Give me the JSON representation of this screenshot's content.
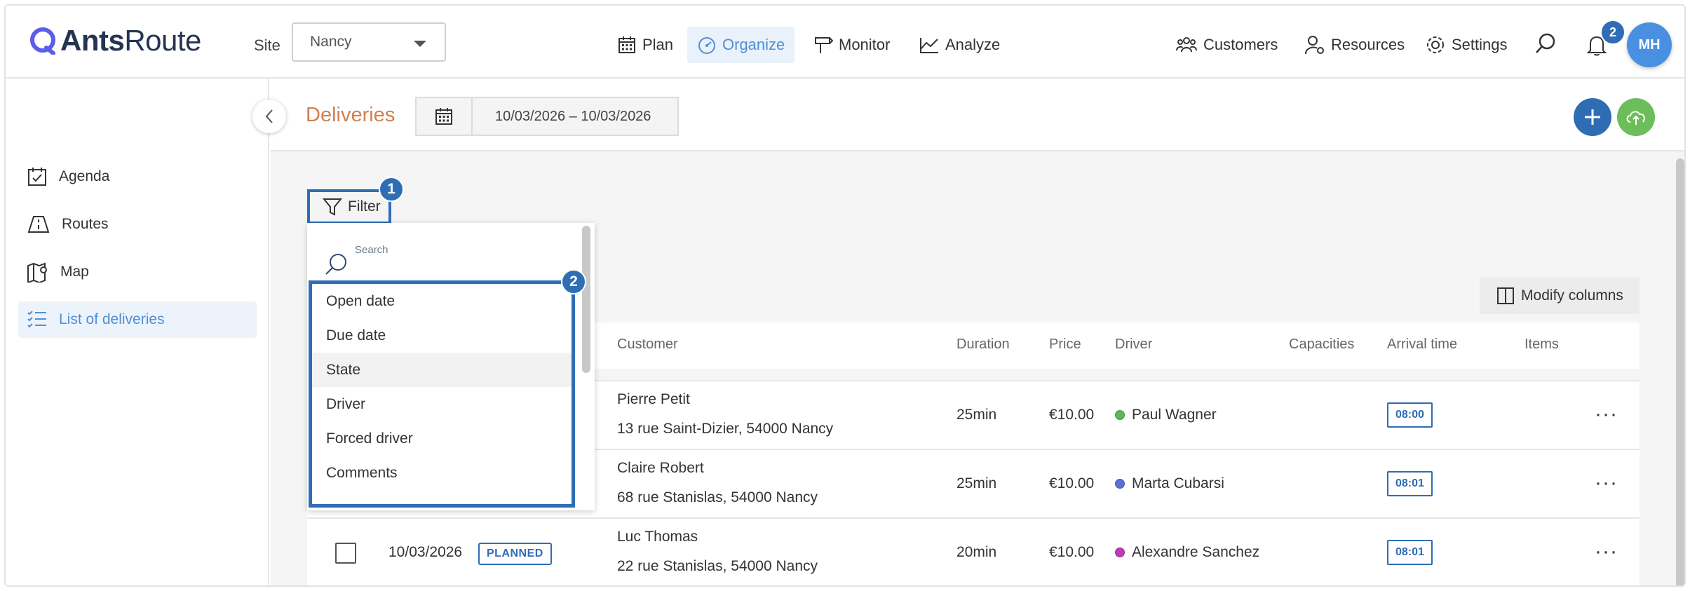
{
  "app": {
    "logo_bold": "Ants",
    "logo_light": "Route"
  },
  "topbar": {
    "site_label": "Site",
    "site_value": "Nancy",
    "nav": [
      {
        "label": "Plan",
        "icon": "calendar-icon"
      },
      {
        "label": "Organize",
        "icon": "speedometer-icon",
        "active": true
      },
      {
        "label": "Monitor",
        "icon": "signpost-icon"
      },
      {
        "label": "Analyze",
        "icon": "chart-icon"
      }
    ],
    "right_nav": [
      {
        "label": "Customers",
        "icon": "people-icon"
      },
      {
        "label": "Resources",
        "icon": "user-gear-icon"
      },
      {
        "label": "Settings",
        "icon": "gear-icon"
      }
    ],
    "notifications_count": "2",
    "avatar_initials": "MH"
  },
  "sidebar": {
    "items": [
      {
        "label": "Agenda",
        "icon": "calendar-check-icon"
      },
      {
        "label": "Routes",
        "icon": "road-icon"
      },
      {
        "label": "Map",
        "icon": "map-pin-icon"
      },
      {
        "label": "List of deliveries",
        "icon": "checklist-icon",
        "active": true
      }
    ]
  },
  "header": {
    "title": "Deliveries",
    "date_range": "10/03/2026 – 10/03/2026"
  },
  "filter": {
    "label": "Filter",
    "badge_1": "1",
    "badge_2": "2",
    "search_placeholder": "Search",
    "options": [
      "Open date",
      "Due date",
      "State",
      "Driver",
      "Forced driver",
      "Comments"
    ],
    "hovered_option": "State"
  },
  "modify_columns_label": "Modify columns",
  "table": {
    "columns": {
      "customer": "Customer",
      "duration": "Duration",
      "price": "Price",
      "driver": "Driver",
      "capacities": "Capacities",
      "arrival": "Arrival time",
      "items": "Items"
    },
    "rows": [
      {
        "date": "",
        "state": "",
        "customer": "Pierre Petit",
        "address": "13 rue Saint-Dizier, 54000 Nancy",
        "duration": "25min",
        "price": "€10.00",
        "driver": "Paul Wagner",
        "driver_color": "#5cb85c",
        "arrival": "08:00"
      },
      {
        "date": "",
        "state": "",
        "customer": "Claire Robert",
        "address": "68 rue Stanislas, 54000 Nancy",
        "duration": "25min",
        "price": "€10.00",
        "driver": "Marta Cubarsi",
        "driver_color": "#5b6fd6",
        "arrival": "08:01"
      },
      {
        "date": "10/03/2026",
        "state": "PLANNED",
        "customer": "Luc Thomas",
        "address": "22 rue Stanislas, 54000 Nancy",
        "duration": "20min",
        "price": "€10.00",
        "driver": "Alexandre Sanchez",
        "driver_color": "#c03ab5",
        "arrival": "08:01"
      }
    ],
    "more_label": "···"
  }
}
